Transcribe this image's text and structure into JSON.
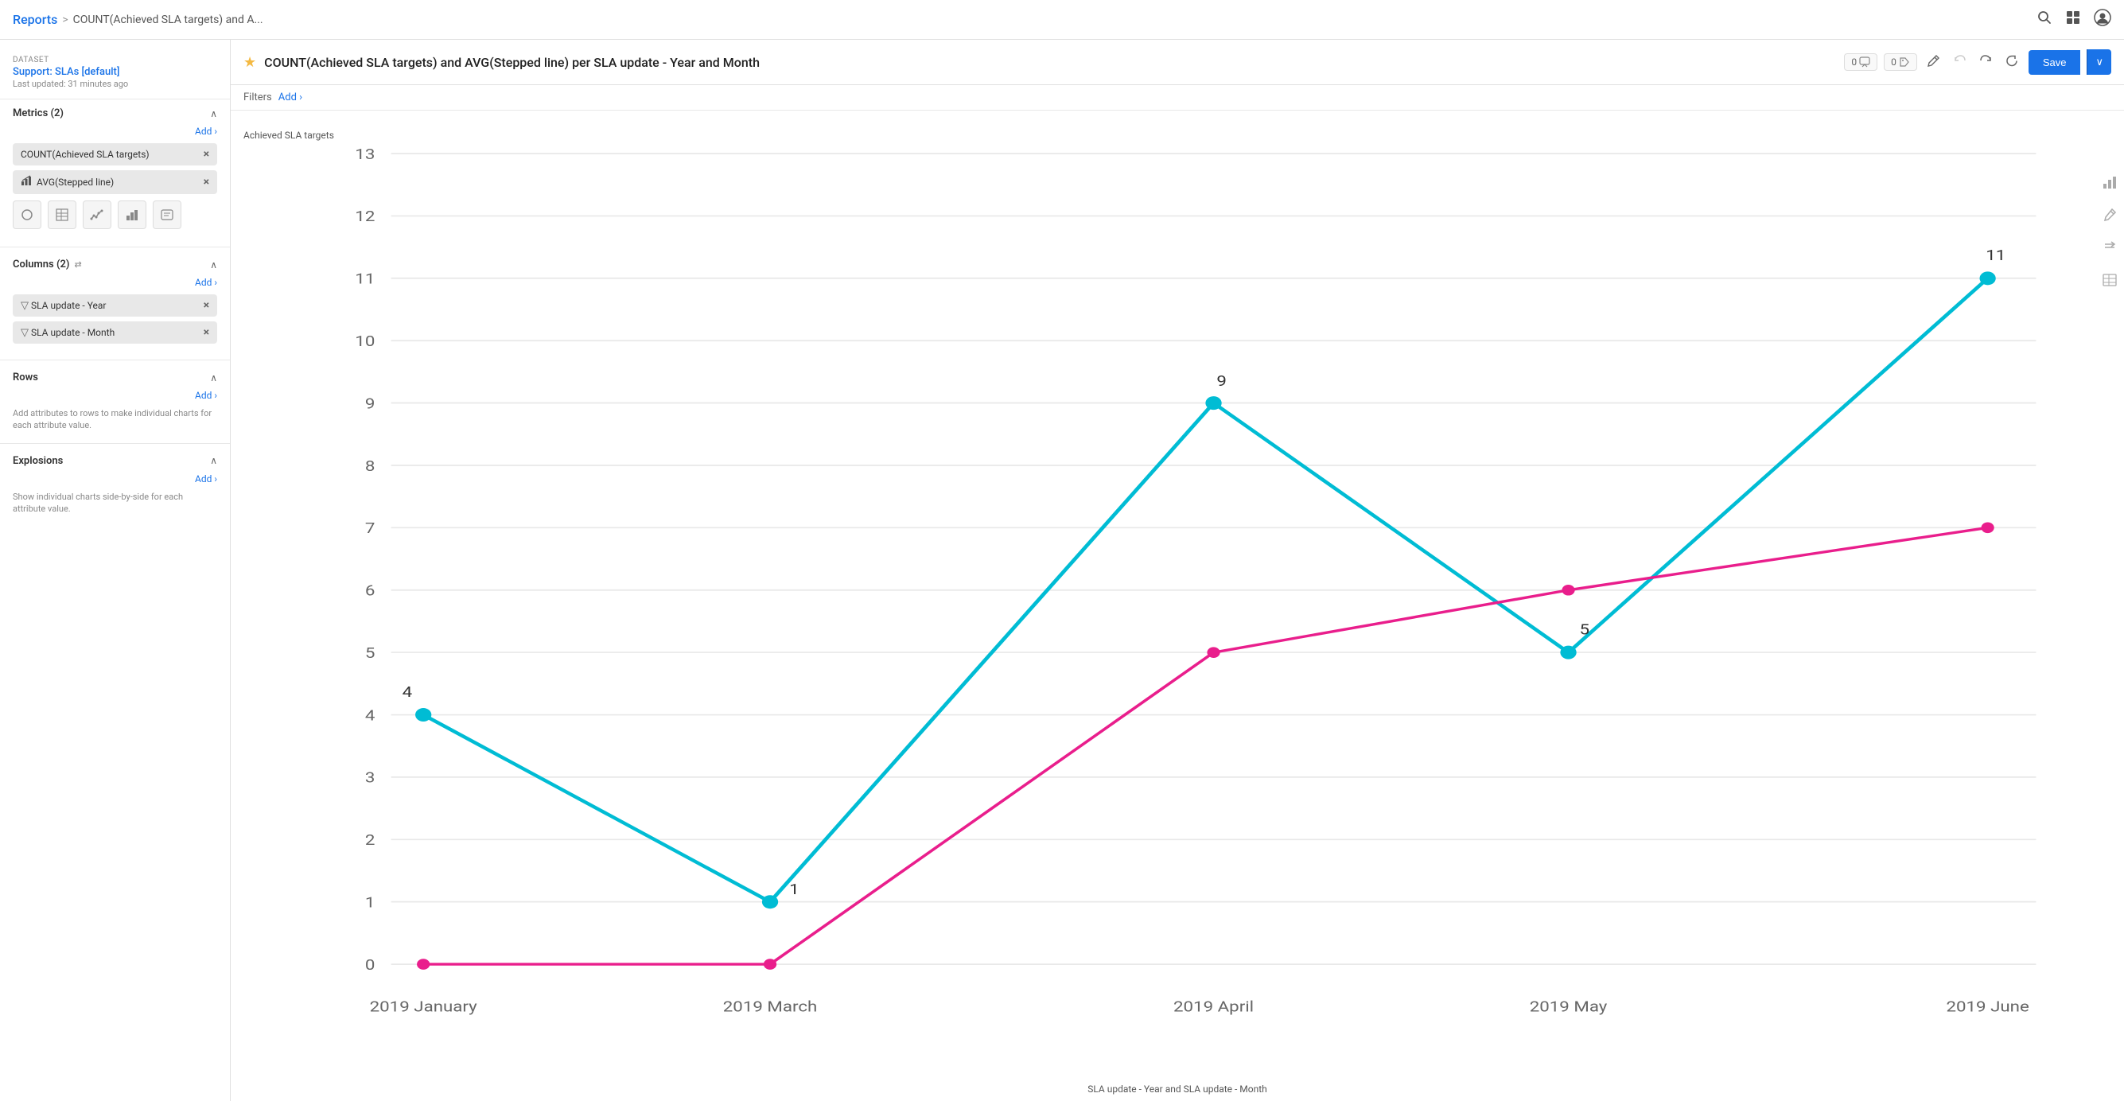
{
  "nav": {
    "reports_label": "Reports",
    "separator": ">",
    "page_title": "COUNT(Achieved SLA targets) and A...",
    "search_icon": "🔍",
    "grid_icon": "⊞",
    "user_icon": "👤"
  },
  "sidebar": {
    "dataset_label": "Dataset",
    "dataset_name": "Support: SLAs [default]",
    "dataset_updated": "Last updated: 31 minutes ago",
    "metrics_title": "Metrics (2)",
    "metrics_add": "Add ›",
    "metrics": [
      {
        "label": "COUNT(Achieved SLA targets)",
        "icon": ""
      },
      {
        "label": "AVG(Stepped line)",
        "icon": "📊"
      }
    ],
    "chart_types": [
      "◯",
      "⊞",
      "〰",
      "📊",
      "💬"
    ],
    "columns_title": "Columns (2)",
    "columns_icon": "⊕",
    "columns_add": "Add ›",
    "columns": [
      {
        "label": "SLA update - Year",
        "icon": "▽"
      },
      {
        "label": "SLA update - Month",
        "icon": "▽"
      }
    ],
    "rows_title": "Rows",
    "rows_add": "Add ›",
    "rows_desc": "Add attributes to rows to make individual charts for each attribute value.",
    "explosions_title": "Explosions",
    "explosions_add": "Add ›",
    "explosions_desc": "Show individual charts side-by-side for each attribute value."
  },
  "report": {
    "title": "COUNT(Achieved SLA targets) and AVG(Stepped line) per SLA update - Year and Month",
    "star": "★",
    "badge_count1": "0",
    "badge_count2": "0",
    "save_label": "Save",
    "filters_label": "Filters",
    "filters_add": "Add ›"
  },
  "chart": {
    "y_axis_label": "Achieved SLA targets",
    "x_axis_label": "SLA update - Year and SLA update - Month",
    "y_ticks": [
      "0",
      "1",
      "2",
      "3",
      "4",
      "5",
      "6",
      "7",
      "8",
      "9",
      "10",
      "11",
      "12",
      "13"
    ],
    "x_labels": [
      "2019 January",
      "2019 March",
      "2019 April",
      "2019 May",
      "2019 June"
    ],
    "cyan_points": [
      {
        "x": 0,
        "y": 4,
        "label": "4"
      },
      {
        "x": 1,
        "y": 1,
        "label": "1"
      },
      {
        "x": 2,
        "y": 9,
        "label": "9"
      },
      {
        "x": 3,
        "y": 5,
        "label": "5"
      },
      {
        "x": 4,
        "y": 11,
        "label": "11"
      }
    ],
    "pink_points": [
      {
        "x": 0,
        "y": 0,
        "label": ""
      },
      {
        "x": 1,
        "y": 0,
        "label": ""
      },
      {
        "x": 2,
        "y": 5,
        "label": ""
      },
      {
        "x": 3,
        "y": 6,
        "label": ""
      },
      {
        "x": 4,
        "y": 7,
        "label": ""
      }
    ]
  },
  "right_toolbar": {
    "bar_chart_icon": "📊",
    "brush_icon": "✏",
    "sort_icon": "↕",
    "table_icon": "⊟"
  }
}
